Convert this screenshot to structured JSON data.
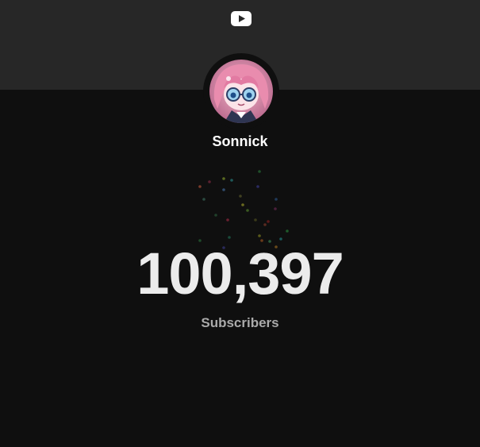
{
  "header": {
    "logo_icon": "youtube-play-icon",
    "background": "#272727",
    "logo_color": "#ffffff"
  },
  "channel": {
    "name": "Sonnick",
    "avatar_icon": "channel-avatar"
  },
  "counter": {
    "value": "100,397",
    "label": "Subscribers"
  },
  "colors": {
    "page_background": "#0f0f0f",
    "count_color": "#ececec",
    "label_color": "#aaaaaa"
  }
}
